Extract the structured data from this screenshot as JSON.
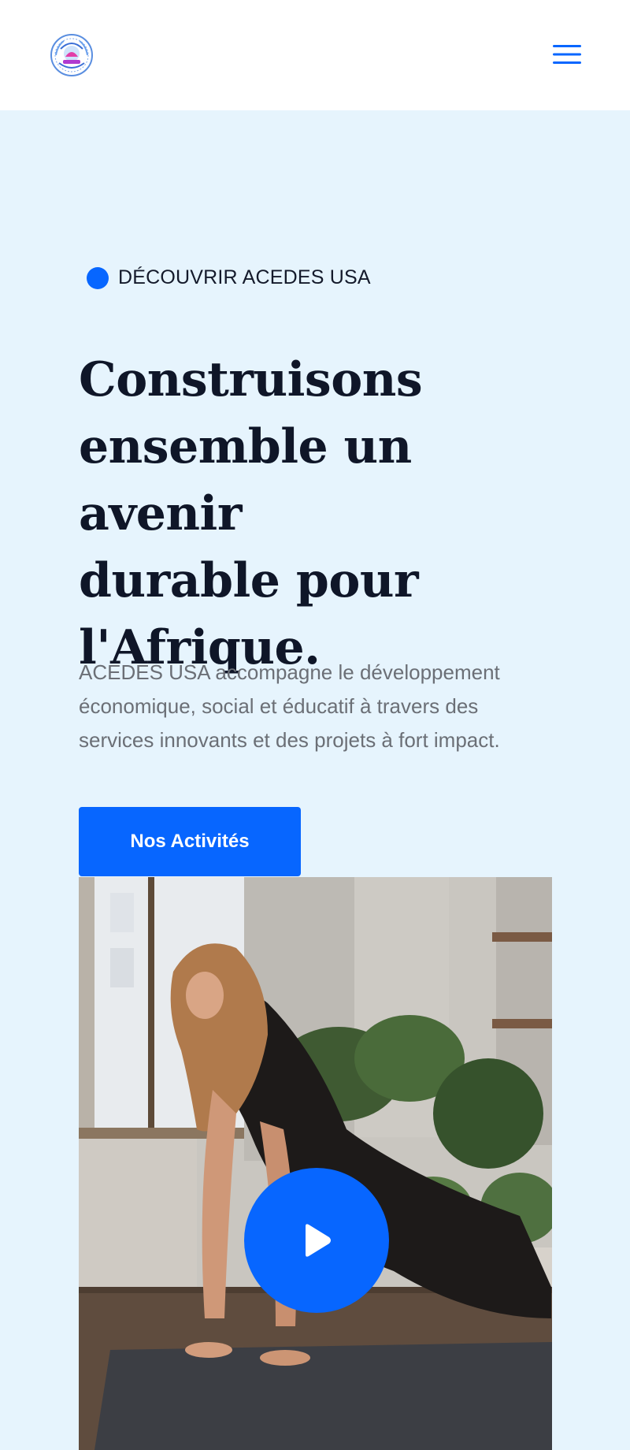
{
  "header": {
    "logo_text": "ACEDES - USA",
    "menu_icon": "hamburger-menu-icon"
  },
  "hero": {
    "eyebrow": "DÉCOUVRIR ACEDES USA",
    "title_lines": [
      "Construisons",
      "ensemble un avenir",
      "durable pour",
      "l'Afrique."
    ],
    "description": "ACEDES USA accompagne le développement économique, social et éducatif à travers des services innovants et des projets à fort impact.",
    "cta_label": "Nos Activités",
    "media": {
      "play_icon": "play-icon"
    }
  },
  "colors": {
    "accent": "#0766ff",
    "hero_background": "#e6f4fd",
    "title": "#0f1628",
    "body_text": "#6b6f76"
  }
}
